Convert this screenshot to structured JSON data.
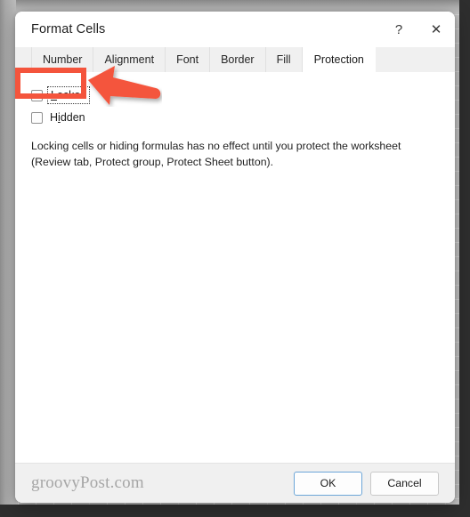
{
  "background": {
    "app": "excel-worksheet-grid"
  },
  "dialog": {
    "title": "Format Cells",
    "titlebar_buttons": [
      {
        "name": "help-button",
        "icon": "question-mark-icon",
        "glyph": "?"
      },
      {
        "name": "close-button",
        "icon": "close-icon",
        "glyph": "✕"
      }
    ],
    "tabs": [
      {
        "label": "Number",
        "active": false
      },
      {
        "label": "Alignment",
        "active": false
      },
      {
        "label": "Font",
        "active": false
      },
      {
        "label": "Border",
        "active": false
      },
      {
        "label": "Fill",
        "active": false
      },
      {
        "label": "Protection",
        "active": true
      }
    ],
    "active_tab": "Protection",
    "protection_panel": {
      "checkboxes": [
        {
          "label": "Locked",
          "accelerator": "L",
          "label_before": "",
          "label_after": "ocked",
          "checked": false,
          "focused": true
        },
        {
          "label": "Hidden",
          "accelerator": "i",
          "label_before": "H",
          "label_after": "dden",
          "checked": false,
          "focused": false
        }
      ],
      "help_text": "Locking cells or hiding formulas has no effect until you protect the worksheet (Review tab, Protect group, Protect Sheet button)."
    },
    "footer": {
      "watermark": "groovyPost.com",
      "buttons": [
        {
          "label": "OK",
          "focused": true
        },
        {
          "label": "Cancel",
          "focused": false
        }
      ]
    }
  },
  "annotations": {
    "highlight_rectangle": {
      "name": "locked-checkbox-highlight",
      "color": "#f4543c",
      "target": "Locked"
    },
    "arrow": {
      "name": "callout-arrow",
      "color": "#f4543c",
      "direction": "left",
      "points_at": "Locked"
    }
  },
  "colors": {
    "accent_annotation": "#f4543c",
    "dialog_background": "#ffffff",
    "tabstrip_background": "#f0f0f0",
    "footer_background": "#f0f0f0",
    "focus_border": "#6ba5d7",
    "watermark_text": "#a6a6a6"
  }
}
